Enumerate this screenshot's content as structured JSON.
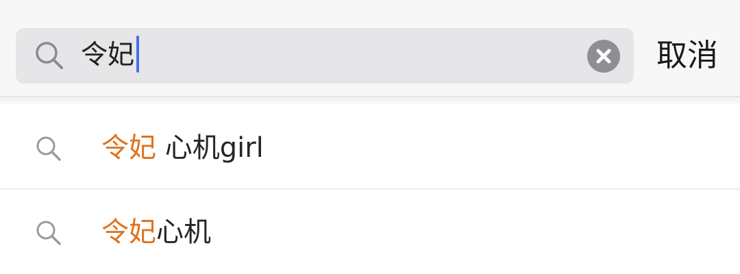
{
  "search": {
    "query": "令妃",
    "cancel_label": "取消"
  },
  "suggestions": [
    {
      "highlight": "令妃",
      "rest": " 心机girl"
    },
    {
      "highlight": "令妃",
      "rest": "心机"
    }
  ],
  "colors": {
    "highlight": "#e0731e",
    "caret": "#4a6ff0",
    "search_box_bg": "#e6e6e8",
    "clear_button_bg": "#8f8f93"
  },
  "icons": {
    "search": "search-icon",
    "clear": "clear-icon"
  }
}
